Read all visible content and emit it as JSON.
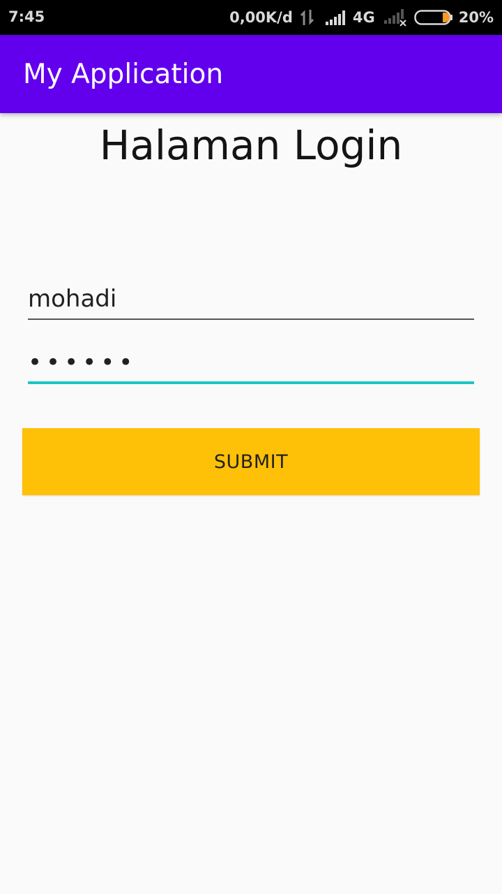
{
  "status_bar": {
    "time": "7:45",
    "speed": "0,00K/d",
    "network_type": "4G",
    "battery_percent_label": "20%",
    "battery_level": 0.2,
    "icons": [
      "updown-arrows-icon",
      "cell-signal-icon",
      "cell-signal-no-service-icon",
      "battery-icon"
    ]
  },
  "app_bar": {
    "title": "My Application",
    "color": "#6200ee"
  },
  "main": {
    "heading": "Halaman Login",
    "username": {
      "value": "mohadi"
    },
    "password": {
      "value": "••••••",
      "focus_color": "#1cc6c6"
    },
    "submit": {
      "label": "SUBMIT",
      "color": "#ffc107"
    }
  }
}
